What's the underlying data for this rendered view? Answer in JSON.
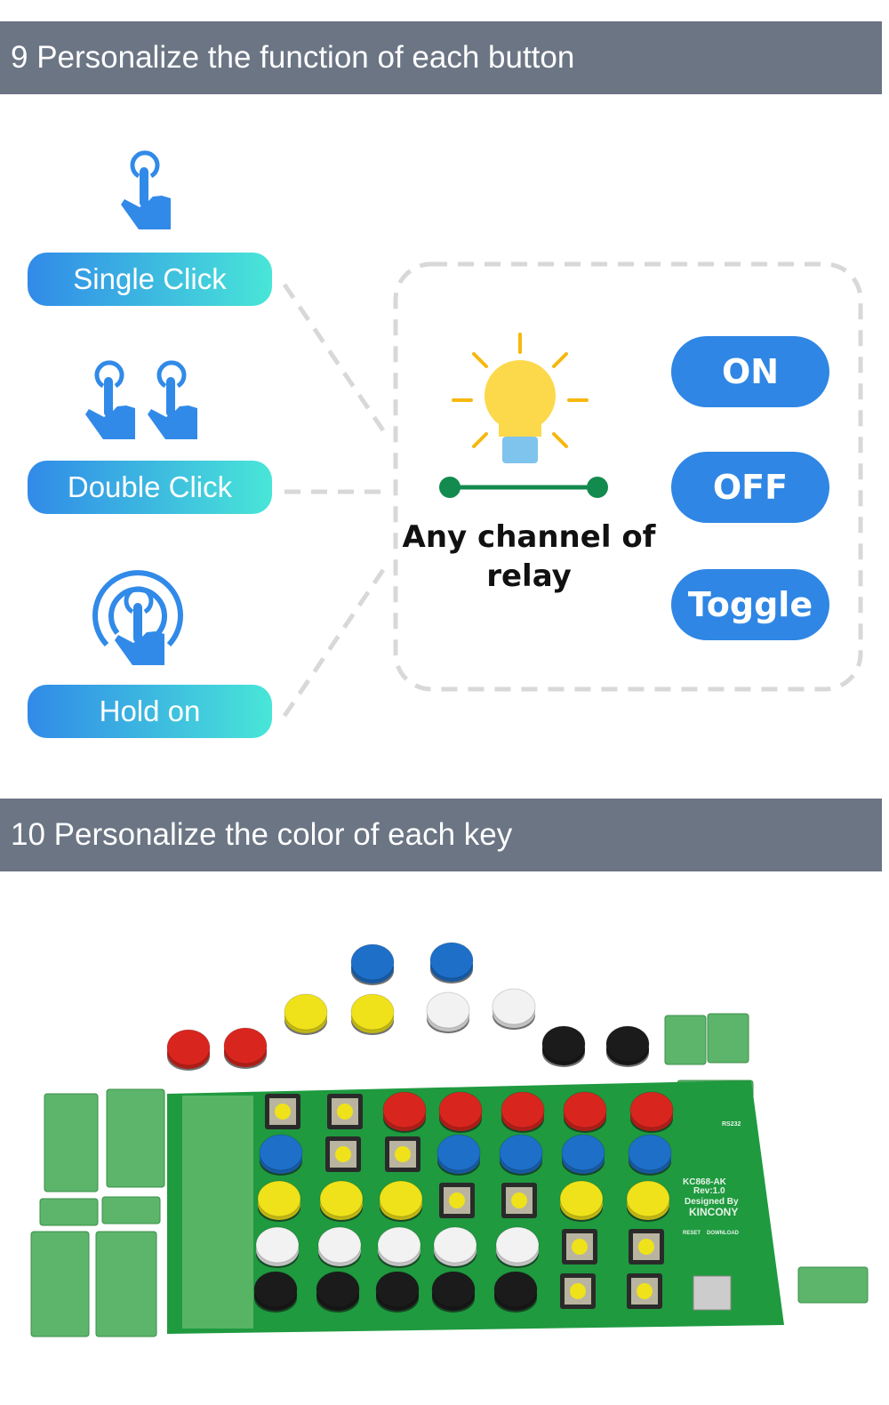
{
  "section9": {
    "title": "9 Personalize the function of each button",
    "triggers": [
      {
        "label": "Single Click",
        "icon": "single-tap-hand-icon"
      },
      {
        "label": "Double Click",
        "icon": "double-tap-hand-icon"
      },
      {
        "label": "Hold on",
        "icon": "hold-press-hand-icon"
      }
    ],
    "relay_label": "Any channel of relay",
    "relay_icon": "light-bulb-icon",
    "states": [
      "ON",
      "OFF",
      "Toggle"
    ]
  },
  "section10": {
    "title": "10 Personalize the color of each key",
    "board": {
      "model": "KC868-AK",
      "rev": "Rev:1.0",
      "designed": "Designed By",
      "brand": "KINCONY",
      "port": "RS232",
      "reset": "RESET",
      "download": "DOWNLOAD"
    },
    "key_rows": [
      [
        "tactile",
        "tactile",
        "red",
        "red",
        "red",
        "red",
        "red"
      ],
      [
        "blue",
        "tactile",
        "tactile",
        "blue",
        "blue",
        "blue",
        "blue"
      ],
      [
        "yellow",
        "yellow",
        "yellow",
        "tactile",
        "tactile",
        "yellow",
        "yellow"
      ],
      [
        "white",
        "white",
        "white",
        "white",
        "white",
        "tactile",
        "tactile"
      ],
      [
        "black",
        "black",
        "black",
        "black",
        "black",
        "tactile",
        "tactile"
      ]
    ],
    "loose_caps": [
      "red",
      "red",
      "yellow",
      "yellow",
      "blue",
      "blue",
      "white",
      "white",
      "black",
      "black"
    ]
  },
  "colors": {
    "header": "#6b7584",
    "accent": "#2f86e4",
    "pcb": "#1f9a3f",
    "red": "#d8261f",
    "blue": "#1e6fc8",
    "yellow": "#efe21a",
    "white": "#f2f2f2",
    "black": "#1b1b1b",
    "tactile": "#c9c2a6",
    "terminal": "#5cb56a"
  }
}
